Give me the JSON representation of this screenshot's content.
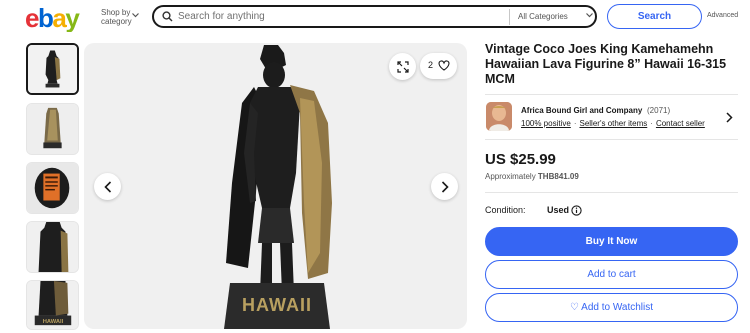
{
  "header": {
    "logo_text": "ebay",
    "logo_colors": [
      "#e53238",
      "#0064d2",
      "#f5af02",
      "#86b817"
    ],
    "shop_by_line1": "Shop by",
    "shop_by_line2": "category",
    "search_placeholder": "Search for anything",
    "category_select": "All Categories",
    "search_button": "Search",
    "advanced_link": "Advanced"
  },
  "gallery": {
    "thumbnails": 5,
    "active_thumbnail": 1,
    "watch_count": "2"
  },
  "product": {
    "title": "Vintage Coco Joes King Kamehamehn Hawaiian Lava Figurine 8” Hawaii 16-315 MCM",
    "figurine_base_text": "HAWAII",
    "price": "US $25.99",
    "approx_label": "Approximately",
    "approx_value": "THB841.09",
    "condition_label": "Condition:",
    "condition_value": "Used"
  },
  "seller": {
    "name": "Africa Bound Girl and Company",
    "feedback_count": "(2071)",
    "positive": "100% positive",
    "other_items": "Seller's other items",
    "contact": "Contact seller"
  },
  "actions": {
    "buy_now": "Buy It Now",
    "add_to_cart": "Add to cart",
    "add_to_watchlist": "♡ Add to Watchlist"
  },
  "colors": {
    "accent_blue": "#3665f3",
    "figurine_black": "#1a1a1a",
    "cape_gold": "#a88a4a"
  }
}
